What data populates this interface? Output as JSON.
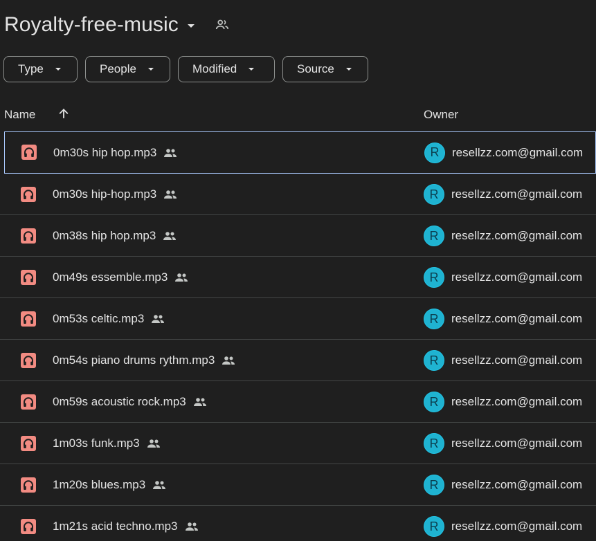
{
  "folder": {
    "title": "Royalty-free-music",
    "shared_icon": "people-outline-icon"
  },
  "filters": [
    {
      "label": "Type"
    },
    {
      "label": "People"
    },
    {
      "label": "Modified"
    },
    {
      "label": "Source"
    }
  ],
  "table": {
    "headers": {
      "name": "Name",
      "owner": "Owner",
      "sort_icon": "arrow-up-icon"
    },
    "rows": [
      {
        "name": "0m30s hip hop.mp3",
        "owner_initial": "R",
        "owner_email": "resellzz.com@gmail.com",
        "selected": true
      },
      {
        "name": "0m30s hip-hop.mp3",
        "owner_initial": "R",
        "owner_email": "resellzz.com@gmail.com"
      },
      {
        "name": "0m38s hip hop.mp3",
        "owner_initial": "R",
        "owner_email": "resellzz.com@gmail.com"
      },
      {
        "name": "0m49s essemble.mp3",
        "owner_initial": "R",
        "owner_email": "resellzz.com@gmail.com"
      },
      {
        "name": "0m53s celtic.mp3",
        "owner_initial": "R",
        "owner_email": "resellzz.com@gmail.com"
      },
      {
        "name": "0m54s piano drums rythm.mp3",
        "owner_initial": "R",
        "owner_email": "resellzz.com@gmail.com"
      },
      {
        "name": "0m59s acoustic rock.mp3",
        "owner_initial": "R",
        "owner_email": "resellzz.com@gmail.com"
      },
      {
        "name": "1m03s funk.mp3",
        "owner_initial": "R",
        "owner_email": "resellzz.com@gmail.com"
      },
      {
        "name": "1m20s blues.mp3",
        "owner_initial": "R",
        "owner_email": "resellzz.com@gmail.com"
      },
      {
        "name": "1m21s acid techno.mp3",
        "owner_initial": "R",
        "owner_email": "resellzz.com@gmail.com"
      }
    ]
  },
  "colors": {
    "background": "#1f1f1f",
    "audio_icon": "#f28b82",
    "avatar": "#1fb3d1",
    "selection_border": "#a8c7fa"
  },
  "icons": {
    "file": "headphones-audio-file-icon",
    "shared": "people-icon"
  }
}
